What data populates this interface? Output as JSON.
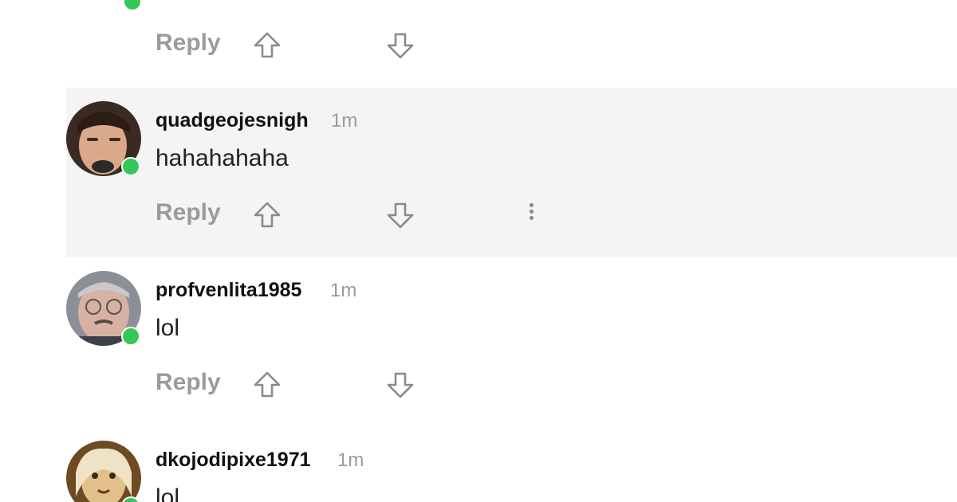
{
  "actions": {
    "reply_label": "Reply",
    "upvote_icon": "arrow-up-outline-icon",
    "downvote_icon": "arrow-down-outline-icon",
    "more_icon": "vertical-ellipsis-icon"
  },
  "colors": {
    "online": "#35c75a",
    "highlight_bg": "#f4f4f4",
    "muted_text": "#9b9b9b"
  },
  "comments": [
    {
      "username": "quadgeojesnigh",
      "time": "1m",
      "text": "hahahahaha",
      "highlighted": true,
      "online": true
    },
    {
      "username": "profvenlita1985",
      "time": "1m",
      "text": "lol",
      "highlighted": false,
      "online": true
    },
    {
      "username": "dkojodipixe1971",
      "time": "1m",
      "text": "lol",
      "highlighted": false,
      "online": true
    }
  ]
}
